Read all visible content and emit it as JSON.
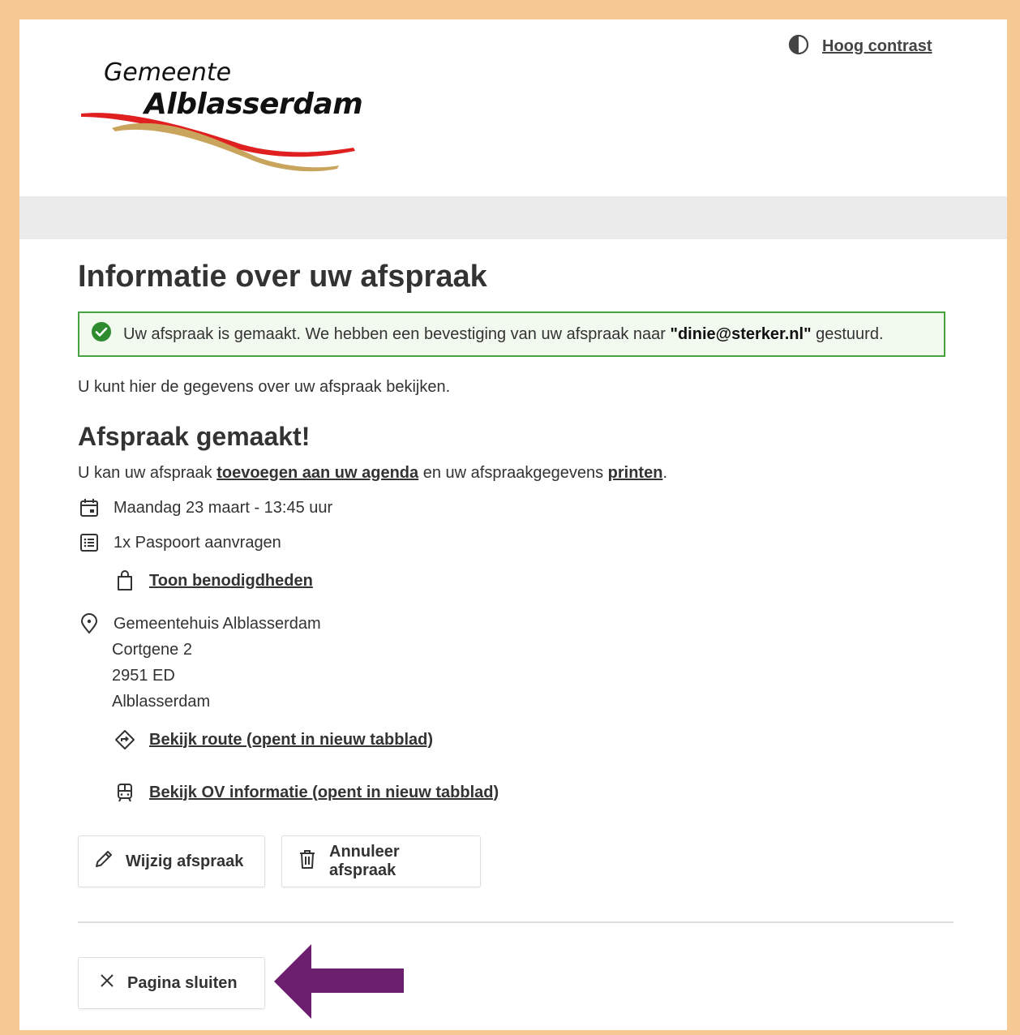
{
  "header": {
    "contrast_label": "Hoog contrast",
    "logo_line1": "Gemeente",
    "logo_line2": "Alblasserdam"
  },
  "main": {
    "title": "Informatie over uw afspraak",
    "alert": {
      "text_before": "Uw afspraak is gemaakt. We hebben een bevestiging van uw afspraak naar ",
      "email": "\"dinie@sterker.nl\"",
      "text_after": " gestuurd."
    },
    "intro": "U kunt hier de gegevens over uw afspraak bekijken.",
    "subtitle": "Afspraak gemaakt!",
    "add_line": {
      "prefix": "U kan uw afspraak ",
      "agenda_link": "toevoegen aan uw agenda",
      "middle": " en uw afspraakgegevens ",
      "print_link": "printen",
      "suffix": "."
    },
    "date": "Maandag 23 maart - 13:45 uur",
    "product": "1x Paspoort aanvragen",
    "requirements_link": "Toon benodigdheden",
    "location": {
      "name": "Gemeentehuis Alblasserdam",
      "street": "Cortgene 2",
      "postcode": "2951 ED",
      "city": "Alblasserdam"
    },
    "route_link": "Bekijk route (opent in nieuw tabblad)",
    "ov_link": "Bekijk OV informatie (opent in nieuw tabblad)",
    "edit_button": "Wijzig afspraak",
    "cancel_button": "Annuleer afspraak",
    "close_button": "Pagina sluiten"
  },
  "colors": {
    "frame_border": "#f5c894",
    "success_green": "#48a23f",
    "arrow_purple": "#6b1f6e"
  }
}
